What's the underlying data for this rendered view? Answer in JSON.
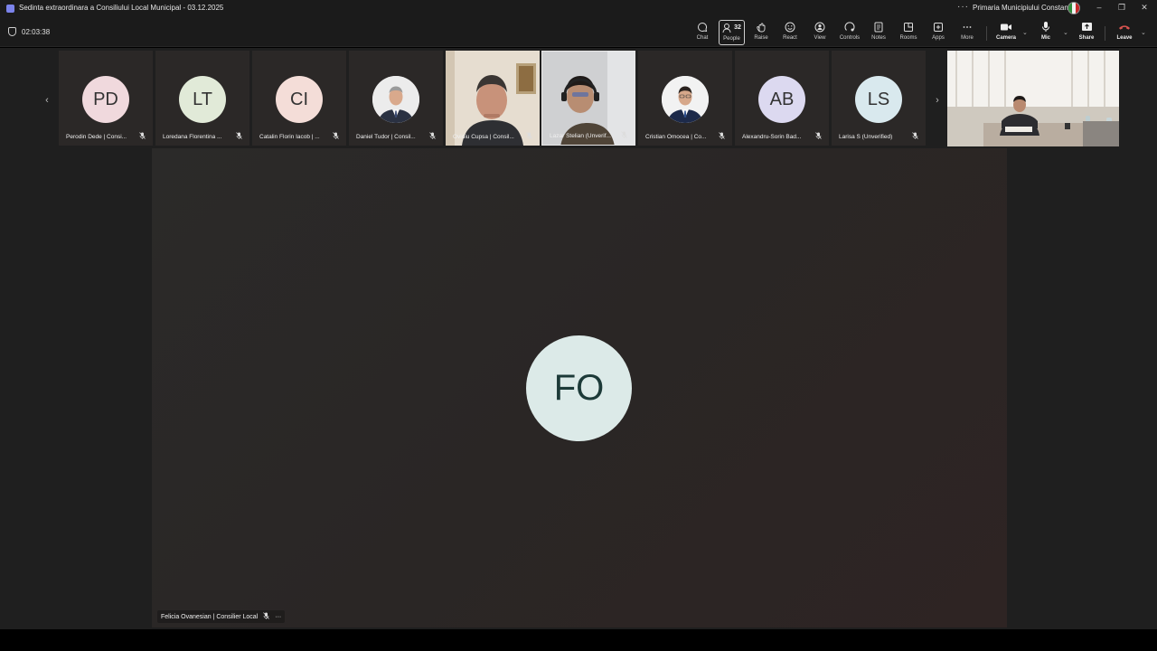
{
  "window": {
    "title": "Sedinta extraordinara a Consiliului Local Municipal - 03.12.2025",
    "more": "···",
    "org_name": "Primaria Municipiului Constanta",
    "minimize": "–",
    "restore": "❐",
    "close": "✕"
  },
  "meeting": {
    "timer": "02:03:38"
  },
  "toolbar": {
    "chat": "Chat",
    "people": "People",
    "people_count": "32",
    "raise": "Raise",
    "react": "React",
    "view": "View",
    "controls": "Controls",
    "notes": "Notes",
    "rooms": "Rooms",
    "apps": "Apps",
    "more": "More",
    "camera": "Camera",
    "mic": "Mic",
    "share": "Share",
    "leave": "Leave"
  },
  "strip": {
    "prev": "‹",
    "next": "›",
    "participants": [
      {
        "initials": "PD",
        "name": "Perodin Dede | Consi...",
        "color": "#f0d9dd"
      },
      {
        "initials": "LT",
        "name": "Loredana Florentina ...",
        "color": "#e1ead8"
      },
      {
        "initials": "CI",
        "name": "Catalin Florin Iacob | ...",
        "color": "#f4ddd8"
      },
      {
        "initials": "",
        "name": "Daniel Tudor | Consil...",
        "color": ""
      },
      {
        "initials": "",
        "name": "Ovidiu Cupsa | Consil...",
        "color": ""
      },
      {
        "initials": "",
        "name": "Lazar Stelian (Unverif...",
        "color": ""
      },
      {
        "initials": "",
        "name": "Cristian Omocea | Co...",
        "color": ""
      },
      {
        "initials": "AB",
        "name": "Alexandru-Sorin Bad...",
        "color": "#dcd9f0"
      },
      {
        "initials": "LS",
        "name": "Larisa S (Unverified)",
        "color": "#d9e9ee"
      }
    ]
  },
  "main": {
    "initials": "FO",
    "name": "Felicia Ovanesian | Consilier Local",
    "more": "···"
  },
  "icons": {
    "mic_off": "🎙"
  }
}
